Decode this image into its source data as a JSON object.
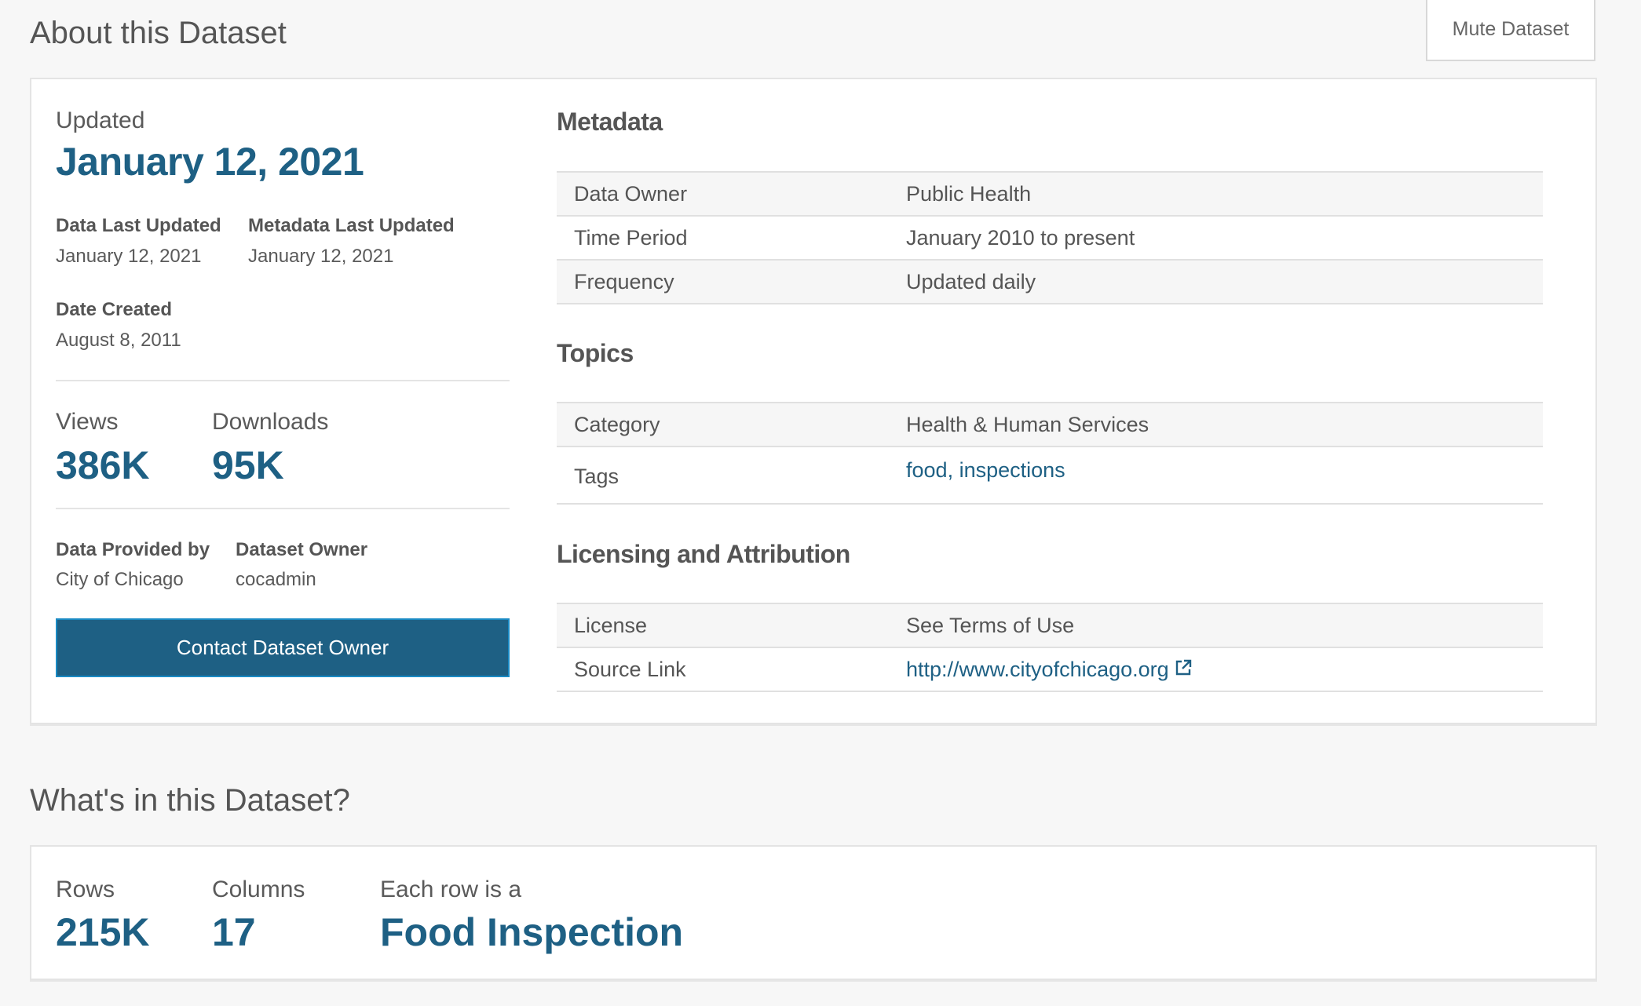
{
  "about": {
    "title": "About this Dataset",
    "mute_button": "Mute Dataset",
    "updated_label": "Updated",
    "updated_date": "January 12, 2021",
    "data_last_updated_label": "Data Last Updated",
    "data_last_updated_value": "January 12, 2021",
    "metadata_last_updated_label": "Metadata Last Updated",
    "metadata_last_updated_value": "January 12, 2021",
    "date_created_label": "Date Created",
    "date_created_value": "August 8, 2011",
    "views_label": "Views",
    "views_value": "386K",
    "downloads_label": "Downloads",
    "downloads_value": "95K",
    "provided_by_label": "Data Provided by",
    "provided_by_value": "City of Chicago",
    "owner_label": "Dataset Owner",
    "owner_value": "cocadmin",
    "contact_button": "Contact Dataset Owner"
  },
  "metadata": {
    "heading": "Metadata",
    "rows": [
      {
        "key": "Data Owner",
        "value": "Public Health"
      },
      {
        "key": "Time Period",
        "value": "January 2010 to present"
      },
      {
        "key": "Frequency",
        "value": "Updated daily"
      }
    ]
  },
  "topics": {
    "heading": "Topics",
    "category_key": "Category",
    "category_value": "Health & Human Services",
    "tags_key": "Tags",
    "tag_1": "food",
    "tag_sep": ", ",
    "tag_2": "inspections"
  },
  "licensing": {
    "heading": "Licensing and Attribution",
    "license_key": "License",
    "license_value": "See Terms of Use",
    "source_key": "Source Link",
    "source_value": "http://www.cityofchicago.org",
    "source_icon": "external-link-icon"
  },
  "whats": {
    "title": "What's in this Dataset?",
    "rows_label": "Rows",
    "rows_value": "215K",
    "columns_label": "Columns",
    "columns_value": "17",
    "row_is_label": "Each row is a",
    "row_is_value": "Food Inspection"
  },
  "colors": {
    "accent": "#1e6084",
    "background": "#f7f7f7",
    "card": "#ffffff"
  }
}
